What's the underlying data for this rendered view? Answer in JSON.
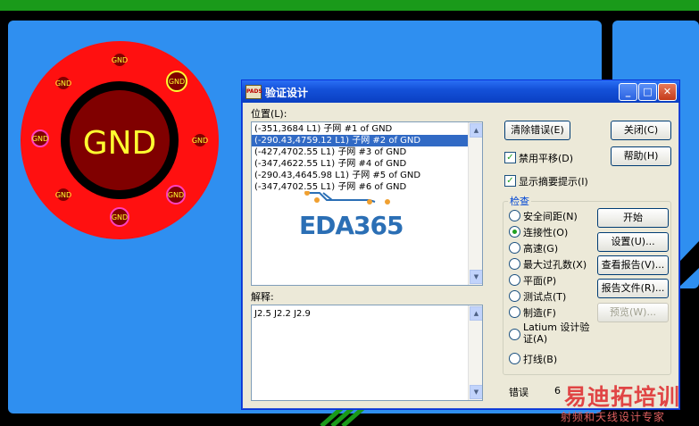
{
  "board": {
    "pad_center_label": "GND",
    "pad_small_label": "GND"
  },
  "dialog": {
    "title": "验证设计",
    "icon_text": "PADS",
    "position_label": "位置(L):",
    "list_items": [
      "(-351,3684 L1) 子网 #1 of GND",
      "(-290.43,4759.12 L1) 子网 #2 of GND",
      "(-427,4702.55 L1) 子网 #3 of GND",
      "(-347,4622.55 L1) 子网 #4 of GND",
      "(-290.43,4645.98 L1) 子网 #5 of GND",
      "(-347,4702.55 L1) 子网 #6 of GND"
    ],
    "selected_index": 1,
    "explain_label": "解释:",
    "explain_text": "J2.5 J2.2 J2.9",
    "buttons": {
      "clear_errors": "清除错误(E)",
      "close": "关闭(C)",
      "help": "帮助(H)",
      "start": "开始",
      "setup": "设置(U)...",
      "view_report": "查看报告(V)...",
      "report_file": "报告文件(R)...",
      "preview": "预览(W)..."
    },
    "checkboxes": {
      "disable_plane": "禁用平移(D)",
      "show_summary": "显示摘要提示(I)"
    },
    "check_group": {
      "title": "检查",
      "options": [
        "安全间距(N)",
        "连接性(O)",
        "高速(G)",
        "最大过孔数(X)",
        "平面(P)",
        "测试点(T)",
        "制造(F)",
        "Latium 设计验证(A)",
        "打线(B)"
      ],
      "selected_index": 1
    },
    "errors_label": "错误",
    "errors_count": "6"
  },
  "watermark": {
    "center": "EDA365",
    "corner_brand": "易迪拓培训",
    "corner_sub": "射频和天线设计专家"
  },
  "colors": {
    "board_blue": "#2f8ff0",
    "pad_red": "#ff1010",
    "pad_inner": "#800000",
    "gnd_yellow": "#ffff30",
    "magenta": "#ff40c0",
    "trace_green": "#1a9a1a"
  }
}
